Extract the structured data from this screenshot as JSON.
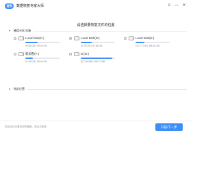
{
  "app": {
    "logo_text": "易我",
    "title": "数据恢复专家大师"
  },
  "window_controls": {
    "menu": "≡",
    "minimize": "—",
    "close": "✕"
  },
  "heading": "请选择要恢复文件的位置",
  "sections": {
    "drives_label": "硬盘分区/设备",
    "specific_label": "指定位置"
  },
  "drives": [
    {
      "name": "Local Disk(C:)",
      "size": "35.65 GB | 99.44 GB",
      "used": 0.36
    },
    {
      "name": "Local Disk(D:)",
      "size": "31.04 GB | 97.66 GB",
      "used": 0.32
    },
    {
      "name": "Local Disk(E:)",
      "size": "117.77 GB | 454.60 GB",
      "used": 0.26
    },
    {
      "name": "新加卷(F:)",
      "size": "21.08 GB | 98.06 GB",
      "used": 0.21
    },
    {
      "name": "D:(G:)",
      "size": "827.36 MB | 898.72 MB",
      "used": 0.92
    }
  ],
  "footer": {
    "hint": "若在此处未看到您的硬盘，请点击刷新",
    "next_button": "扫描/下一步"
  },
  "colors": {
    "accent": "#3e8ef7",
    "track": "#e3e6ea"
  }
}
